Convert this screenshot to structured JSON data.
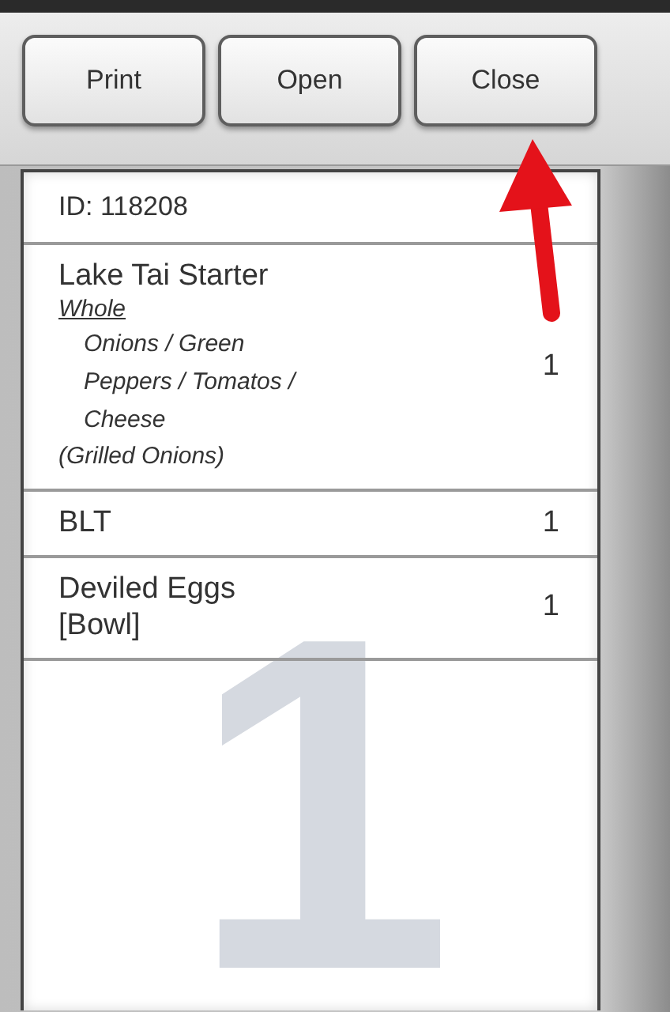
{
  "toolbar": {
    "buttons": [
      {
        "label": "Print"
      },
      {
        "label": "Open"
      },
      {
        "label": "Close"
      }
    ]
  },
  "ticket": {
    "id": "ID: 118208",
    "watermark_number": "1",
    "items": [
      {
        "name": "Lake Tai Starter",
        "size": "Whole",
        "modifiers": "Onions / Green Peppers / Tomatos / Cheese",
        "note": "(Grilled Onions)",
        "qty": "1"
      },
      {
        "name": "BLT",
        "qty": "1"
      },
      {
        "name": "Deviled Eggs",
        "portion": "[Bowl]",
        "qty": "1"
      }
    ]
  },
  "annotation": {
    "kind": "arrow"
  }
}
